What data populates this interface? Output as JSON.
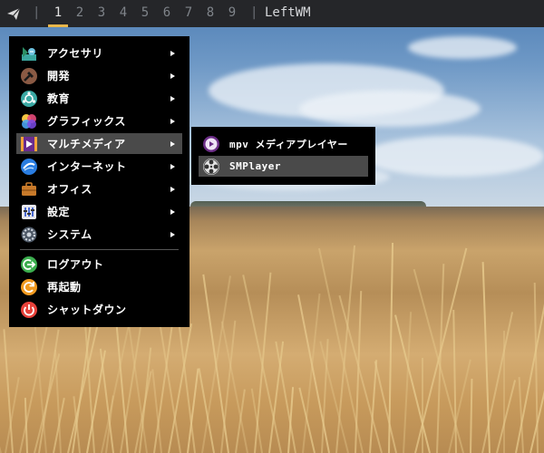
{
  "topbar": {
    "tags": [
      "1",
      "2",
      "3",
      "4",
      "5",
      "6",
      "7",
      "8",
      "9"
    ],
    "active_tag": "1",
    "separator": "|",
    "title": "LeftWM",
    "accent_color": "#e8b64a"
  },
  "main_menu": {
    "items": [
      {
        "label": "アクセサリ",
        "icon": "accessories-icon",
        "submenu": true
      },
      {
        "label": "開発",
        "icon": "development-icon",
        "submenu": true
      },
      {
        "label": "教育",
        "icon": "education-icon",
        "submenu": true
      },
      {
        "label": "グラフィックス",
        "icon": "graphics-icon",
        "submenu": true
      },
      {
        "label": "マルチメディア",
        "icon": "multimedia-icon",
        "submenu": true,
        "highlighted": true
      },
      {
        "label": "インターネット",
        "icon": "internet-icon",
        "submenu": true
      },
      {
        "label": "オフィス",
        "icon": "office-icon",
        "submenu": true
      },
      {
        "label": "設定",
        "icon": "settings-icon",
        "submenu": true
      },
      {
        "label": "システム",
        "icon": "system-icon",
        "submenu": true
      }
    ],
    "actions": [
      {
        "label": "ログアウト",
        "icon": "logout-icon"
      },
      {
        "label": "再起動",
        "icon": "reboot-icon"
      },
      {
        "label": "シャットダウン",
        "icon": "shutdown-icon"
      }
    ]
  },
  "sub_menu": {
    "items": [
      {
        "label": "mpv メディアプレイヤー",
        "icon": "mpv-icon"
      },
      {
        "label": "SMPlayer",
        "icon": "smplayer-icon",
        "highlighted": true
      }
    ]
  }
}
